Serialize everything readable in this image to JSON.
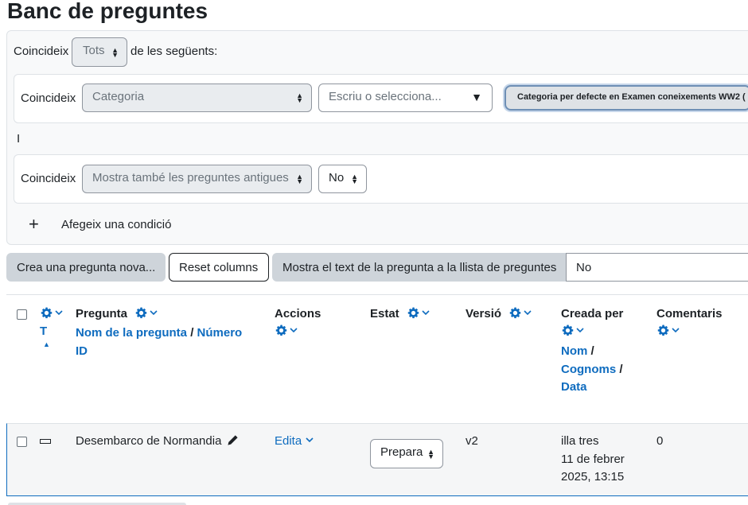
{
  "page": {
    "title": "Banc de preguntes"
  },
  "filters": {
    "match_prefix": "Coincideix",
    "match_mode": "Tots",
    "match_suffix": "de les següents:",
    "conditions": [
      {
        "label": "Coincideix",
        "type": "Categoria",
        "search_placeholder": "Escriu o selecciona...",
        "selected_chip": "Categoria per defecte en Examen coneixements WW2 ("
      },
      {
        "label": "Coincideix",
        "type": "Mostra també les preguntes antigues",
        "value": "No"
      }
    ],
    "join_word": "I",
    "add_icon": "+",
    "add_condition_label": "Afegeix una condició"
  },
  "toolbar": {
    "create_label": "Crea una pregunta nova...",
    "reset_label": "Reset columns",
    "show_text_label": "Mostra el text de la pregunta a la llista de preguntes",
    "show_text_value": "No"
  },
  "table": {
    "headers": {
      "type_sort": "T",
      "question": "Pregunta",
      "question_name": "Nom de la pregunta",
      "separator": "/",
      "id_number": "Número ID",
      "id_number_l1": "Número",
      "id_number_l2": "ID",
      "actions": "Accions",
      "status": "Estat",
      "version": "Versió",
      "created_by": "Creada per",
      "first_name": "Nom",
      "last_name": "Cognoms",
      "date": "Data",
      "comments": "Comentaris"
    },
    "rows": [
      {
        "name": "Desembarco de Normandia",
        "actions": "Edita",
        "status": "Prepara",
        "version": "v2",
        "creator": "illa tres",
        "date_l1": "11 de febrer",
        "date_l2": "2025, 13:15",
        "comments": "0"
      }
    ]
  },
  "icons": {
    "gear": "gear-icon",
    "chevron": "chevron-down-icon",
    "edit": "pencil-icon",
    "sort": "sort-asc-icon",
    "qtype": "essay-type-icon",
    "add": "plus-icon"
  },
  "colors": {
    "link": "#0f6cbf",
    "text": "#1d2125",
    "disabled_bg": "#e9ecef",
    "button_secondary": "#ced4da"
  }
}
